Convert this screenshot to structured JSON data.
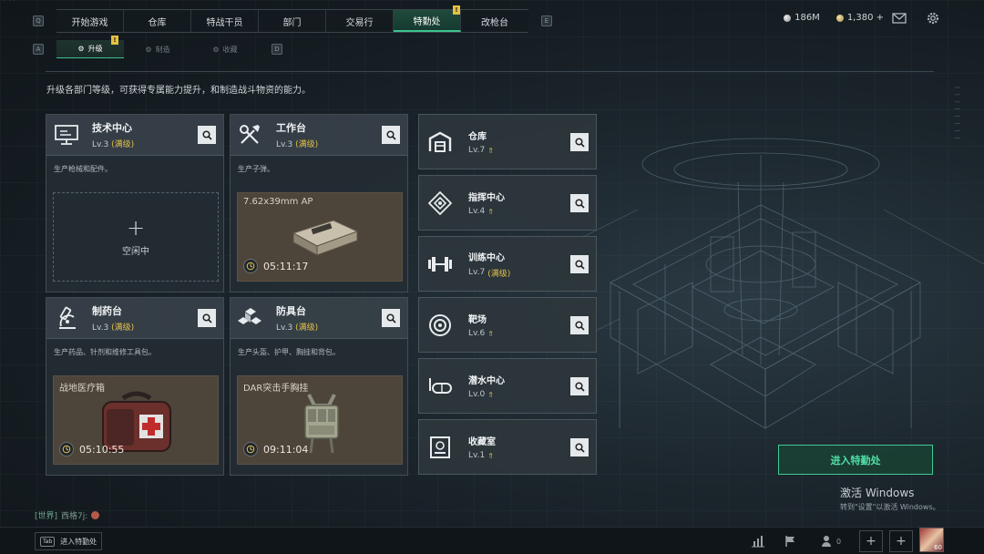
{
  "nav": {
    "key_left": "Q",
    "key_right": "E",
    "tabs": [
      {
        "label": "开始游戏"
      },
      {
        "label": "仓库"
      },
      {
        "label": "特战干员"
      },
      {
        "label": "部门"
      },
      {
        "label": "交易行"
      },
      {
        "label": "特勤处",
        "badge": "!"
      },
      {
        "label": "改枪台"
      }
    ]
  },
  "currency": {
    "silver": "186M",
    "gold": "1,380 +"
  },
  "subnav": {
    "key_left": "A",
    "key_right": "D",
    "tabs": [
      {
        "label": "升级",
        "badge": "!"
      },
      {
        "label": "制造"
      },
      {
        "label": "收藏"
      }
    ]
  },
  "description": "升级各部门等级，可获得专属能力提升，和制造战斗物资的能力。",
  "workshops": [
    {
      "name": "技术中心",
      "level": "Lv.3",
      "max_label": "(满级)",
      "icon": "monitor-icon",
      "desc": "生产枪械和配件。",
      "slot": {
        "state": "empty",
        "plus": "+",
        "label": "空闲中"
      }
    },
    {
      "name": "工作台",
      "level": "Lv.3",
      "max_label": "(满级)",
      "icon": "tools-icon",
      "desc": "生产子弹。",
      "slot": {
        "state": "busy",
        "item": "7.62x39mm AP",
        "time": "05:11:17"
      }
    },
    {
      "name": "制药台",
      "level": "Lv.3",
      "max_label": "(满级)",
      "icon": "microscope-icon",
      "desc": "生产药品、针剂和维修工具包。",
      "slot": {
        "state": "busy",
        "item": "战地医疗箱",
        "time": "05:10:55"
      }
    },
    {
      "name": "防具台",
      "level": "Lv.3",
      "max_label": "(满级)",
      "icon": "armor-parts-icon",
      "desc": "生产头盔、护甲、胸挂和背包。",
      "slot": {
        "state": "busy",
        "item": "DAR突击手胸挂",
        "time": "09:11:04"
      }
    }
  ],
  "facilities": [
    {
      "name": "仓库",
      "level": "Lv.7",
      "max_label": "",
      "icon": "warehouse-icon"
    },
    {
      "name": "指挥中心",
      "level": "Lv.4",
      "max_label": "",
      "icon": "command-chip-icon"
    },
    {
      "name": "训练中心",
      "level": "Lv.7",
      "max_label": "(满级)",
      "icon": "dumbbell-icon"
    },
    {
      "name": "靶场",
      "level": "Lv.6",
      "max_label": "",
      "icon": "target-icon"
    },
    {
      "name": "潜水中心",
      "level": "Lv.0",
      "max_label": "",
      "icon": "diving-mask-icon"
    },
    {
      "name": "收藏室",
      "level": "Lv.1",
      "max_label": "",
      "icon": "collection-icon"
    }
  ],
  "cta_label": "进入特勤处",
  "activation": {
    "title": "激活 Windows",
    "subtitle": "转到\"设置\"以激活 Windows。"
  },
  "chat": {
    "channel": "[世界]",
    "user": "西格7j:"
  },
  "bottom": {
    "tab_key": "Tab",
    "tab_label": "进入特勤处",
    "friends_count": "0",
    "plus": "+",
    "player_level": "60"
  },
  "colors": {
    "accent_green": "#3dc48f",
    "max_level_gold": "#e3c04a",
    "badge_yellow": "#e4c140"
  }
}
